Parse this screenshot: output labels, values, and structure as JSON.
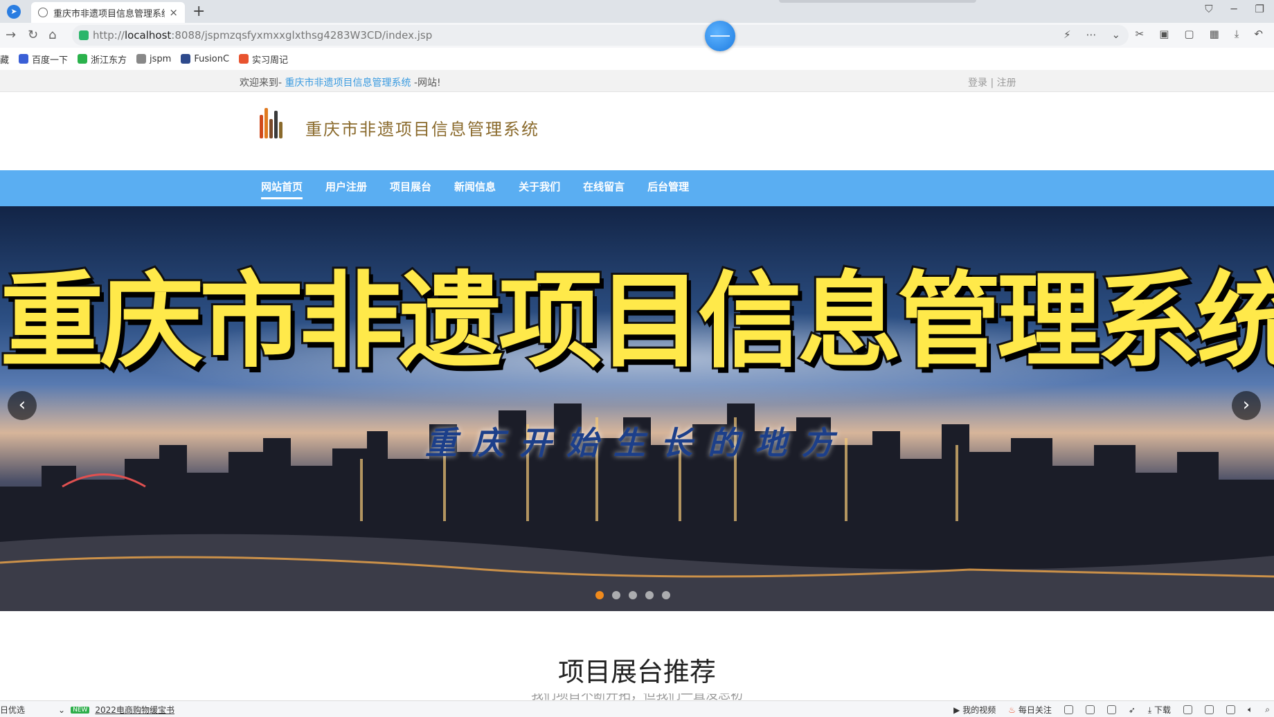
{
  "browser": {
    "tab_title": "重庆市非遗项目信息管理系统",
    "tab_close": "×",
    "new_tab": "+",
    "url_prefix": "http://",
    "url_host": "localhost",
    "url_rest": ":8088/jspmzqsfyxmxxglxthsg4283W3CD/index.jsp",
    "bookmarks": [
      {
        "label": "藏",
        "color": "#ffffff"
      },
      {
        "label": "百度一下",
        "color": "#3a5fd6"
      },
      {
        "label": "浙江东方",
        "color": "#2bb24c"
      },
      {
        "label": "jspm",
        "color": "#888888"
      },
      {
        "label": "FusionC",
        "color": "#2e4a8c"
      },
      {
        "label": "实习周记",
        "color": "#e8532f"
      }
    ]
  },
  "site": {
    "welcome_prefix": "欢迎来到-",
    "welcome_site": "重庆市非遗项目信息管理系统",
    "welcome_suffix": "-网站!",
    "auth": "登录 | 注册",
    "name": "重庆市非遗项目信息管理系统",
    "nav": [
      {
        "label": "网站首页",
        "active": true
      },
      {
        "label": "用户注册",
        "active": false
      },
      {
        "label": "项目展台",
        "active": false
      },
      {
        "label": "新闻信息",
        "active": false
      },
      {
        "label": "关于我们",
        "active": false
      },
      {
        "label": "在线留言",
        "active": false
      },
      {
        "label": "后台管理",
        "active": false
      }
    ],
    "banner": {
      "title": "重庆市非遗项目信息管理系统",
      "subtitle": "重庆开始生长的地方",
      "prev": "‹",
      "next": "›",
      "slide_count": 5,
      "active_slide": 1
    },
    "section_title": "项目展台推荐",
    "section_subtitle": "我们项目不断开拓，但我们一直没忘初"
  },
  "statusbar": {
    "left_text": "日优选",
    "new_badge": "NEW",
    "news": "2022电商购物缓宝书",
    "my_video": "我的视频",
    "daily_focus": "每日关注",
    "download": "下载"
  },
  "colors": {
    "nav_bg": "#5aaef2",
    "accent_link": "#3a9be0",
    "title_yellow": "#ffe94a",
    "active_dot": "#f08a1c"
  }
}
